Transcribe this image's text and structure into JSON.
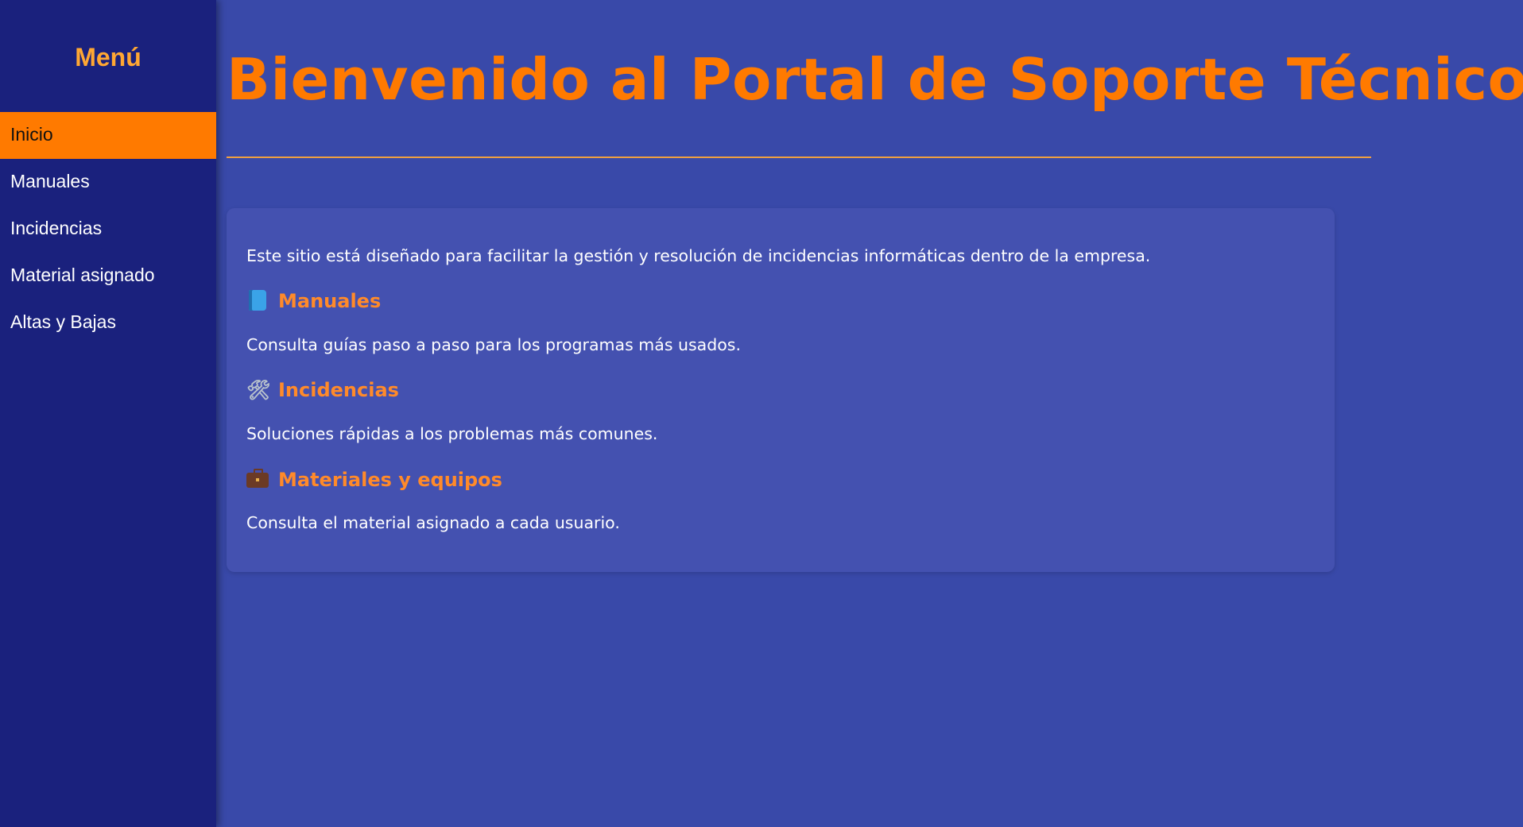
{
  "sidebar": {
    "title": "Menú",
    "items": [
      {
        "label": "Inicio",
        "active": true
      },
      {
        "label": "Manuales",
        "active": false
      },
      {
        "label": "Incidencias",
        "active": false
      },
      {
        "label": "Material asignado",
        "active": false
      },
      {
        "label": "Altas y Bajas",
        "active": false
      }
    ]
  },
  "main": {
    "title": "Bienvenido al Portal de Soporte Técnico",
    "intro": "Este sitio está diseñado para facilitar la gestión y resolución de incidencias informáticas dentro de la empresa.",
    "sections": [
      {
        "icon": "book-icon",
        "heading": "Manuales",
        "text": "Consulta guías paso a paso para los programas más usados."
      },
      {
        "icon": "tools-icon",
        "heading": "Incidencias",
        "text": "Soluciones rápidas a los problemas más comunes."
      },
      {
        "icon": "briefcase-icon",
        "heading": "Materiales y equipos",
        "text": "Consulta el material asignado a cada usuario."
      }
    ]
  },
  "colors": {
    "background": "#3949a9",
    "sidebar": "#1a217d",
    "accent": "#ff7a00",
    "card": "#4451b0"
  }
}
